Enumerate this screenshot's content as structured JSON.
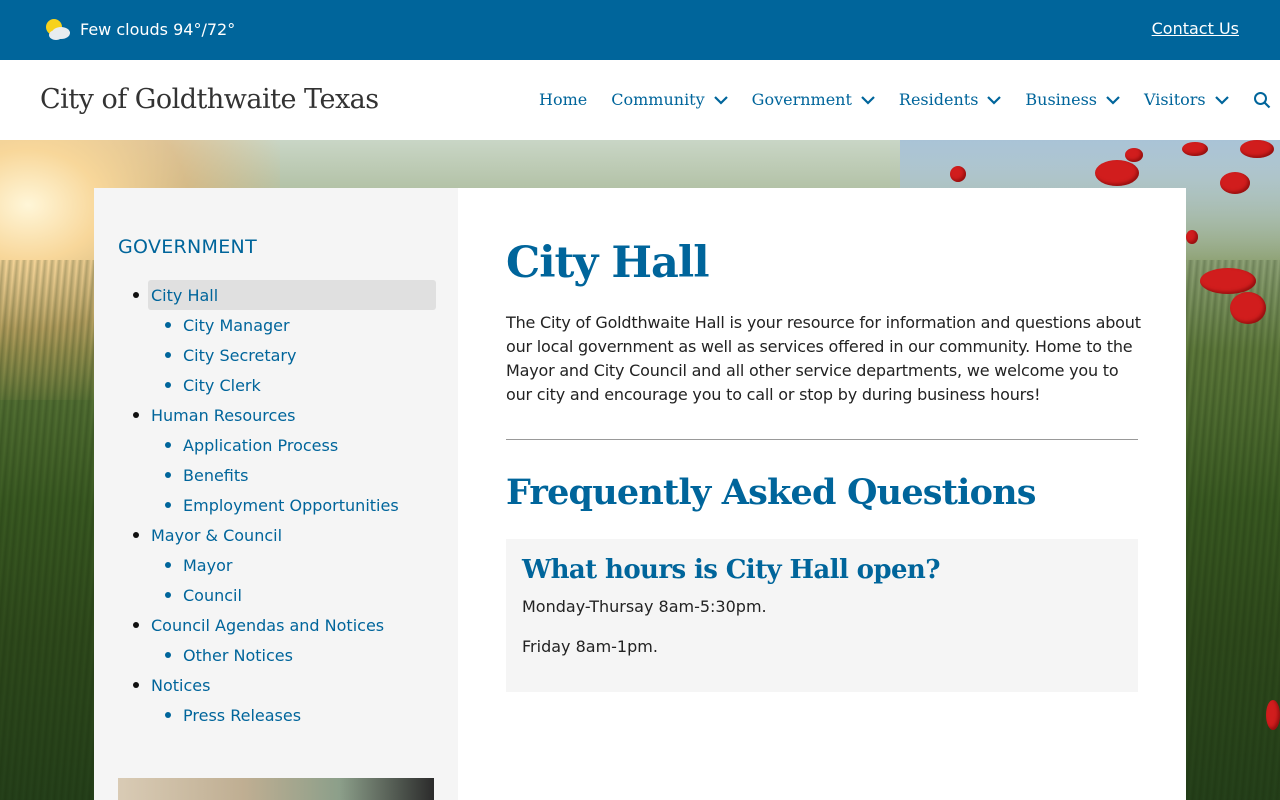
{
  "topbar": {
    "weather_icon": "partly-cloudy-icon",
    "weather_text": "Few clouds 94°/72°",
    "contact_label": "Contact Us"
  },
  "header": {
    "site_title": "City of Goldthwaite Texas",
    "nav": [
      {
        "label": "Home"
      },
      {
        "label": "Community",
        "icon": "chevron-down-icon"
      },
      {
        "label": "Government",
        "icon": "chevron-down-icon"
      },
      {
        "label": "Residents",
        "icon": "chevron-down-icon"
      },
      {
        "label": "Business",
        "icon": "chevron-down-icon"
      },
      {
        "label": "Visitors",
        "icon": "chevron-down-icon"
      }
    ],
    "search_icon": "search-icon"
  },
  "sidebar": {
    "heading": "GOVERNMENT",
    "items": [
      {
        "label": "City Hall",
        "level": 1,
        "active": true
      },
      {
        "label": "City Manager",
        "level": 2
      },
      {
        "label": "City Secretary",
        "level": 2
      },
      {
        "label": "City Clerk",
        "level": 2
      },
      {
        "label": "Human Resources",
        "level": 1
      },
      {
        "label": "Application Process",
        "level": 2
      },
      {
        "label": "Benefits",
        "level": 2
      },
      {
        "label": "Employment Opportunities",
        "level": 2
      },
      {
        "label": "Mayor & Council",
        "level": 1
      },
      {
        "label": "Mayor",
        "level": 2
      },
      {
        "label": "Council",
        "level": 2
      },
      {
        "label": "Council Agendas and Notices",
        "level": 1
      },
      {
        "label": "Other Notices",
        "level": 2
      },
      {
        "label": "Notices",
        "level": 1
      },
      {
        "label": "Press Releases",
        "level": 2
      }
    ]
  },
  "main": {
    "title": "City Hall",
    "intro": "The City of Goldthwaite Hall is your resource for information and questions about our local government as well as services offered in our community.  Home to the Mayor and City Council and all other service departments, we welcome you to our city and encourage you to call or stop by during business hours!",
    "faq_title": "Frequently Asked Questions",
    "faq": {
      "question": "What hours is City Hall open?",
      "answer_1": "Monday-Thursay 8am-5:30pm.",
      "answer_2": "Friday 8am-1pm."
    }
  },
  "colors": {
    "brand_blue": "#00659b",
    "panel_gray": "#f5f5f5",
    "active_gray": "#e0e0e0"
  }
}
